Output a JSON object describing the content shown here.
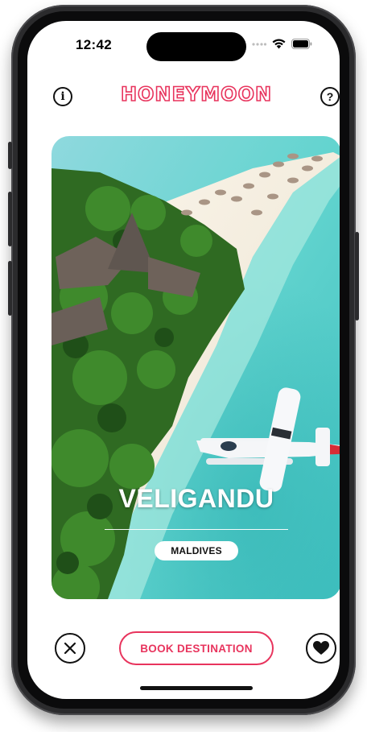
{
  "status_bar": {
    "time": "12:42"
  },
  "header": {
    "logo_text": "HONEYMOON",
    "info_button_label": "i",
    "help_button_label": "?"
  },
  "destination": {
    "name": "VELIGANDU",
    "country": "MALDIVES"
  },
  "actions": {
    "book_label": "BOOK DESTINATION"
  },
  "colors": {
    "accent": "#e8345d",
    "water": "#5fd2cf",
    "sand": "#f4eee2",
    "foliage": "#2f6a22"
  }
}
